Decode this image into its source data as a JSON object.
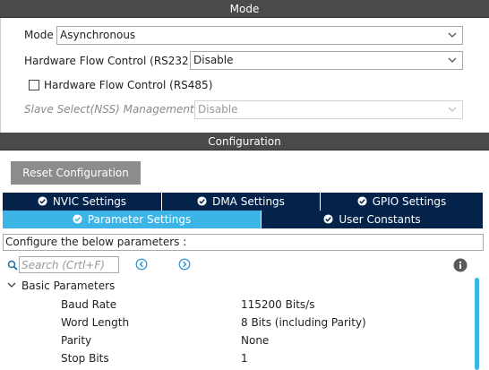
{
  "mode_section": {
    "title": "Mode",
    "mode": {
      "label": "Mode",
      "value": "Asynchronous"
    },
    "rs232": {
      "label": "Hardware Flow Control (RS232)",
      "value": "Disable"
    },
    "rs485": {
      "label": "Hardware Flow Control (RS485)",
      "checked": false
    },
    "nss": {
      "label": "Slave Select(NSS) Management",
      "value": "Disable",
      "disabled": true
    }
  },
  "config_section": {
    "title": "Configuration",
    "reset_label": "Reset Configuration",
    "tabs_row1": [
      {
        "label": "NVIC Settings"
      },
      {
        "label": "DMA Settings"
      },
      {
        "label": "GPIO Settings"
      }
    ],
    "tabs_row2": [
      {
        "label": "Parameter Settings",
        "active": true
      },
      {
        "label": "User Constants"
      }
    ],
    "description": "Configure the below parameters :",
    "search_placeholder": "Search (Crtl+F)",
    "group": {
      "label": "Basic Parameters",
      "params": [
        {
          "name": "Baud Rate",
          "value": "115200 Bits/s"
        },
        {
          "name": "Word Length",
          "value": "8 Bits (including Parity)"
        },
        {
          "name": "Parity",
          "value": "None"
        },
        {
          "name": "Stop Bits",
          "value": "1"
        }
      ]
    }
  },
  "colors": {
    "header_bg": "#4a4a4a",
    "tab_dark": "#03234b",
    "tab_active": "#3cb4e6",
    "button_bg": "#8c8c8c"
  }
}
